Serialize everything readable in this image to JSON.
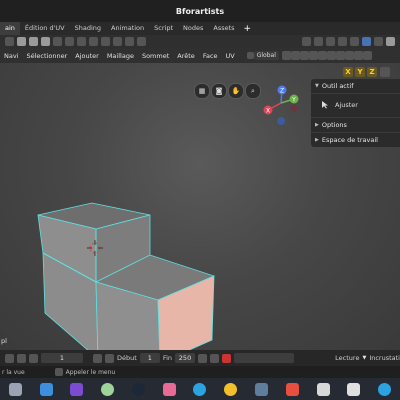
{
  "window": {
    "title": "Bforartists"
  },
  "workspace_tabs": [
    {
      "label": "ain",
      "active": true
    },
    {
      "label": "Édition d'UV",
      "active": false
    },
    {
      "label": "Shading",
      "active": false
    },
    {
      "label": "Animation",
      "active": false
    },
    {
      "label": "Script",
      "active": false
    },
    {
      "label": "Nodes",
      "active": false
    },
    {
      "label": "Assets",
      "active": false
    }
  ],
  "workspace_add": "+",
  "tool_header": {
    "transform_orientation": "Global"
  },
  "menubar": {
    "items": [
      "Navi",
      "Sélectionner",
      "Ajouter",
      "Maillage",
      "Sommet",
      "Arête",
      "Face",
      "UV"
    ]
  },
  "viewport": {
    "axis_buttons": [
      "X",
      "Y",
      "Z"
    ],
    "gizmo": {
      "z": "Z",
      "x": "X",
      "y": "Y"
    },
    "corner_text": "pl"
  },
  "side_panel": {
    "active_tool_header": "Outil actif",
    "active_tool_name": "Ajuster",
    "options_header": "Options",
    "workspace_header": "Espace de travail"
  },
  "timeline": {
    "current_frame": "1",
    "start_label": "Début",
    "start_value": "1",
    "end_label": "Fin",
    "end_value": "250",
    "playback_label": "Lecture",
    "keying_label": "Incrustati"
  },
  "statusbar": {
    "left_text": "r la vue",
    "menu_hint": "Appeler le menu"
  },
  "colors": {
    "accent": "#4772b3",
    "selection_edge": "#5fe0e0",
    "active_face": "#e8b6a8",
    "gizmo_z": "#4c7cf0",
    "gizmo_x": "#e0465a",
    "gizmo_y": "#6bb34a"
  },
  "taskbar_apps": [
    "file-manager-icon",
    "screenshot-icon",
    "feather-icon",
    "inkscape-icon",
    "steam-icon",
    "krita-icon",
    "telegram-icon",
    "chrome-icon",
    "files-icon",
    "flowblade-icon",
    "image-viewer-icon",
    "editor-icon",
    "telegram-icon-2"
  ]
}
